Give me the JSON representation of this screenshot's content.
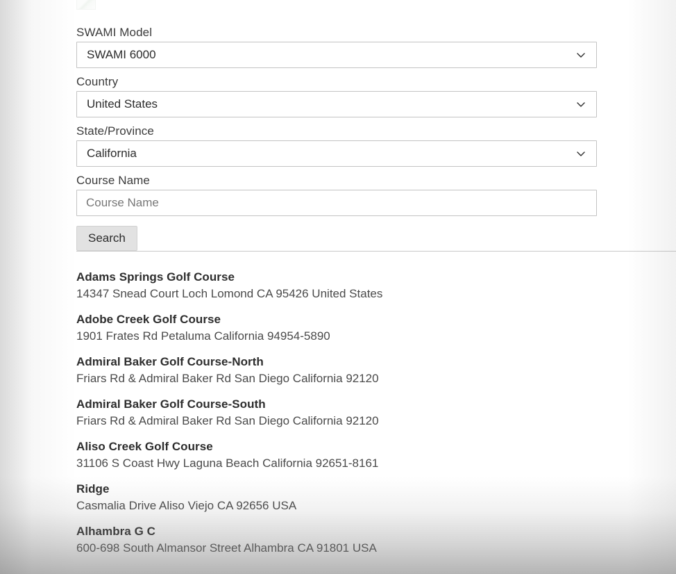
{
  "form": {
    "fields": [
      {
        "label": "SWAMI Model",
        "type": "select",
        "value": "SWAMI 6000",
        "icon": "chevron-down-icon",
        "name": "swami-model"
      },
      {
        "label": "Country",
        "type": "select",
        "value": "United States",
        "icon": "chevron-down-icon",
        "name": "country"
      },
      {
        "label": "State/Province",
        "type": "select",
        "value": "California",
        "icon": "chevron-down-icon",
        "name": "state-province"
      },
      {
        "label": "Course Name",
        "type": "text",
        "value": "",
        "placeholder": "Course Name",
        "name": "course-name"
      }
    ],
    "search_button_label": "Search"
  },
  "results": [
    {
      "name": "Adams Springs Golf Course",
      "address": "14347 Snead Court Loch Lomond CA 95426 United States"
    },
    {
      "name": "Adobe Creek Golf Course",
      "address": "1901 Frates Rd Petaluma California 94954-5890"
    },
    {
      "name": "Admiral Baker Golf Course-North",
      "address": "Friars Rd & Admiral Baker Rd San Diego California 92120"
    },
    {
      "name": "Admiral Baker Golf Course-South",
      "address": "Friars Rd & Admiral Baker Rd San Diego California 92120"
    },
    {
      "name": "Aliso Creek Golf Course",
      "address": "31106 S Coast Hwy Laguna Beach California 92651-8161"
    },
    {
      "name": "Ridge",
      "address": "Casmalia Drive Aliso Viejo CA 92656 USA"
    },
    {
      "name": "Alhambra G C",
      "address": "600-698 South Almansor Street Alhambra CA 91801 USA"
    }
  ],
  "colors": {
    "page_background": "#ffffff",
    "label_text": "#3b3b3b",
    "value_text": "#2b2b2b",
    "address_text": "#4a4a4a",
    "field_border": "#c3c3c3",
    "button_background": "#e2e2e2",
    "divider": "#c9c9c9"
  }
}
